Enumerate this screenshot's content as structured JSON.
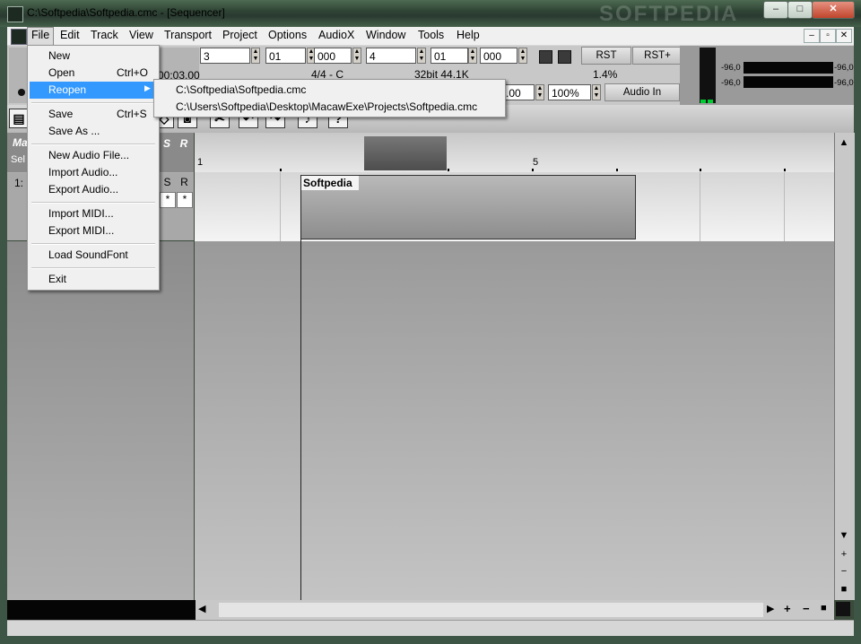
{
  "window": {
    "title": "C:\\Softpedia\\Softpedia.cmc - [Sequencer]",
    "watermark": "SOFTPEDIA",
    "controls": {
      "minimize": "–",
      "maximize": "□",
      "close": "✕"
    }
  },
  "menubar": {
    "items": [
      "File",
      "Edit",
      "Track",
      "View",
      "Transport",
      "Project",
      "Options",
      "AudioX",
      "Window",
      "Tools",
      "Help"
    ]
  },
  "file_menu": {
    "items": [
      {
        "label": "New",
        "shortcut": ""
      },
      {
        "label": "Open",
        "shortcut": "Ctrl+O"
      },
      {
        "label": "Reopen",
        "shortcut": ""
      },
      {
        "label": "Save",
        "shortcut": "Ctrl+S"
      },
      {
        "label": "Save As ...",
        "shortcut": ""
      },
      {
        "label": "New Audio File...",
        "shortcut": ""
      },
      {
        "label": "Import Audio...",
        "shortcut": ""
      },
      {
        "label": "Export Audio...",
        "shortcut": ""
      },
      {
        "label": "Import MIDI...",
        "shortcut": ""
      },
      {
        "label": "Export MIDI...",
        "shortcut": ""
      },
      {
        "label": "Load SoundFont",
        "shortcut": ""
      },
      {
        "label": "Exit",
        "shortcut": ""
      }
    ],
    "highlighted": "Reopen",
    "highlight_color": "#3399ff"
  },
  "reopen_submenu": {
    "items": [
      "C:\\Softpedia\\Softpedia.cmc",
      "C:\\Users\\Softpedia\\Desktop\\MacawExe\\Projects\\Softpedia.cmc"
    ]
  },
  "transport": {
    "fields": [
      "3",
      "01",
      "000",
      "4",
      "01",
      "000"
    ],
    "time_readout": "00:03.00",
    "meter_readout": "4/4 - C",
    "format_readout": "32bit 44.1K",
    "cpu_readout": "1.4%",
    "tempo_partial": ".00",
    "zoom": "100%",
    "rst_label": "RST",
    "rst_plus_label": "RST+",
    "audio_in_label": "Audio In"
  },
  "meters": {
    "left_db_1": "-96,0",
    "right_db_1": "-96,0",
    "left_db_2": "-96,0",
    "right_db_2": "-96,0"
  },
  "track_header": {
    "s_label": "S",
    "r_label": "R",
    "track_number": "1:",
    "s_mark": "*",
    "r_mark": "*",
    "header_partial": "Ma",
    "select_partial": "Sel"
  },
  "timeline": {
    "bar_1": "1",
    "bar_5": "5"
  },
  "clip": {
    "label": "Softpedia"
  }
}
